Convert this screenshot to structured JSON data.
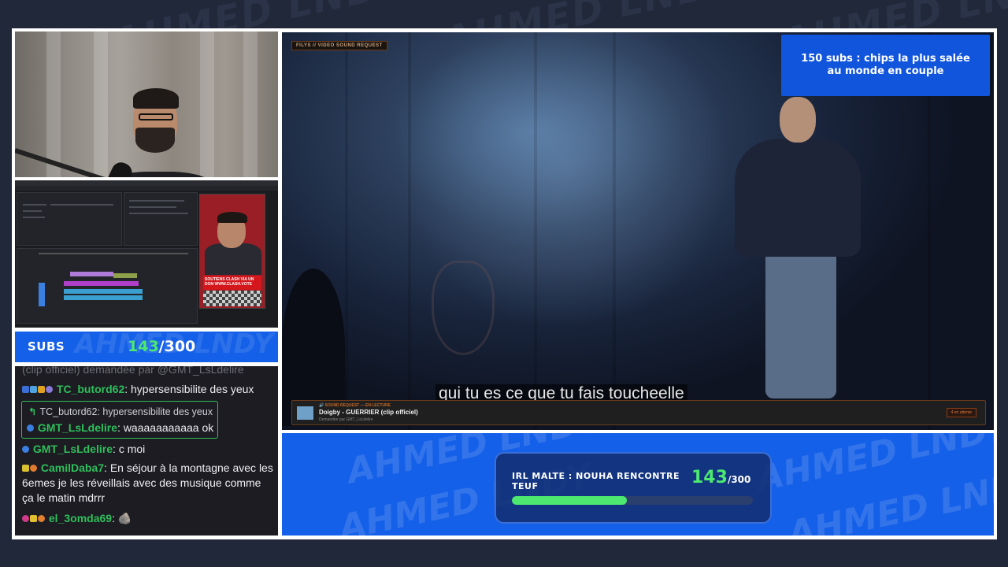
{
  "watermark": "AHMED LNDY",
  "video": {
    "tag": "FILYS // VIDEO SOUND REQUEST",
    "subtitle": "qui tu es ce que tu fais toucheelle",
    "sub_goal_text": "150 subs : chips la plus salée au monde en couple",
    "now_playing": {
      "label": "🔊 SOUND REQUEST — EN LECTURE",
      "title": "Doigby - GUERRIER (clip officiel)",
      "requested_by": "Demandée par GMT_LsLdelire",
      "status": "4 en attente"
    }
  },
  "subs": {
    "label": "SUBS",
    "current": "143",
    "total": "/300"
  },
  "editor": {
    "preview_caption": "SOUTIENS CLASH VIA UN DON WWW.CLASH.VOTE"
  },
  "chat": {
    "ghost_line": "(clip officiel)       demandée par @GMT_LsLdelire",
    "messages": [
      {
        "user": "TC_butord62",
        "text": "hypersensibilite des yeux",
        "color": "#2fbf5b",
        "badges": [
          "#3b6fd6",
          "#4fa3e0",
          "#e0a020",
          "#8a7ad8"
        ]
      },
      {
        "user": "GMT_LsLdelire",
        "text": "c moi",
        "color": "#2fbf5b",
        "badges": [
          "#3b7fe0"
        ]
      },
      {
        "user": "CamilDaba7",
        "text": "En séjour à la montagne avec les 6emes je les réveillais avec des musique comme ça le matin mdrrr",
        "color": "#2fbf5b",
        "badges": [
          "#d8c030",
          "#e07a30"
        ]
      },
      {
        "user": "el_3omda69",
        "text": "🪨",
        "color": "#2fbf5b",
        "badges": [
          "#d03a8a",
          "#e0c030",
          "#e08030"
        ]
      }
    ],
    "reply": {
      "parent_user": "TC_butord62:",
      "parent_text": "hypersensibilite des yeux",
      "user": "GMT_LsLdelire",
      "text": "waaaaaaaaaaa ok"
    }
  },
  "goal": {
    "title": "IRL MALTE : NOUHA RENCONTRE TEUF",
    "current": "143",
    "total": "/300",
    "progress": 0.477
  },
  "colors": {
    "accent_blue": "#1560e8",
    "progress_green": "#4de870",
    "chat_bg": "#1c1c22"
  }
}
